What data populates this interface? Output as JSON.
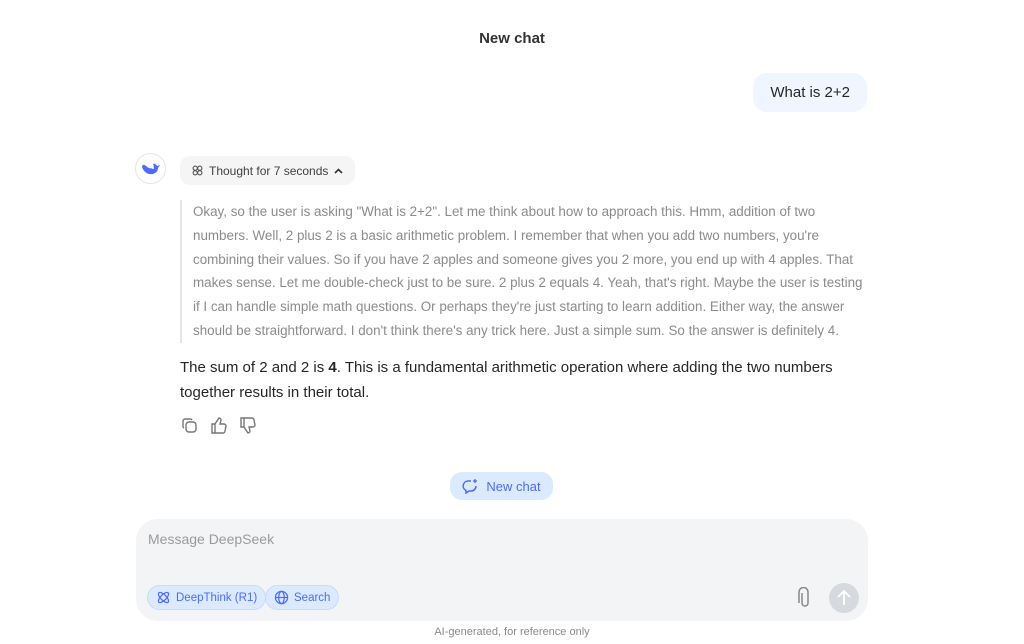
{
  "header": {
    "title": "New chat"
  },
  "conversation": {
    "user_message": "What is 2+2",
    "thought_label": "Thought for 7 seconds",
    "thinking": "Okay, so the user is asking \"What is 2+2\". Let me think about how to approach this. Hmm, addition of two numbers. Well, 2 plus 2 is a basic arithmetic problem. I remember that when you add two numbers, you're combining their values. So if you have 2 apples and someone gives you 2 more, you end up with 4 apples. That makes sense. Let me double-check just to be sure. 2 plus 2 equals 4. Yeah, that's right. Maybe the user is testing if I can handle simple math questions. Or perhaps they're just starting to learn addition. Either way, the answer should be straightforward. I don't think there's any trick here. Just a simple sum. So the answer is definitely 4.",
    "answer_pre": "The sum of 2 and 2 is ",
    "answer_bold": "4",
    "answer_post": ". This is a fundamental arithmetic operation where adding the two numbers together results in their total."
  },
  "new_chat_label": "New chat",
  "composer": {
    "placeholder": "Message DeepSeek",
    "deepthink_label": "DeepThink (R1)",
    "search_label": "Search"
  },
  "footer": "AI-generated, for reference only",
  "colors": {
    "accent": "#4d6bfe",
    "chip_bg": "#dbeafe"
  }
}
